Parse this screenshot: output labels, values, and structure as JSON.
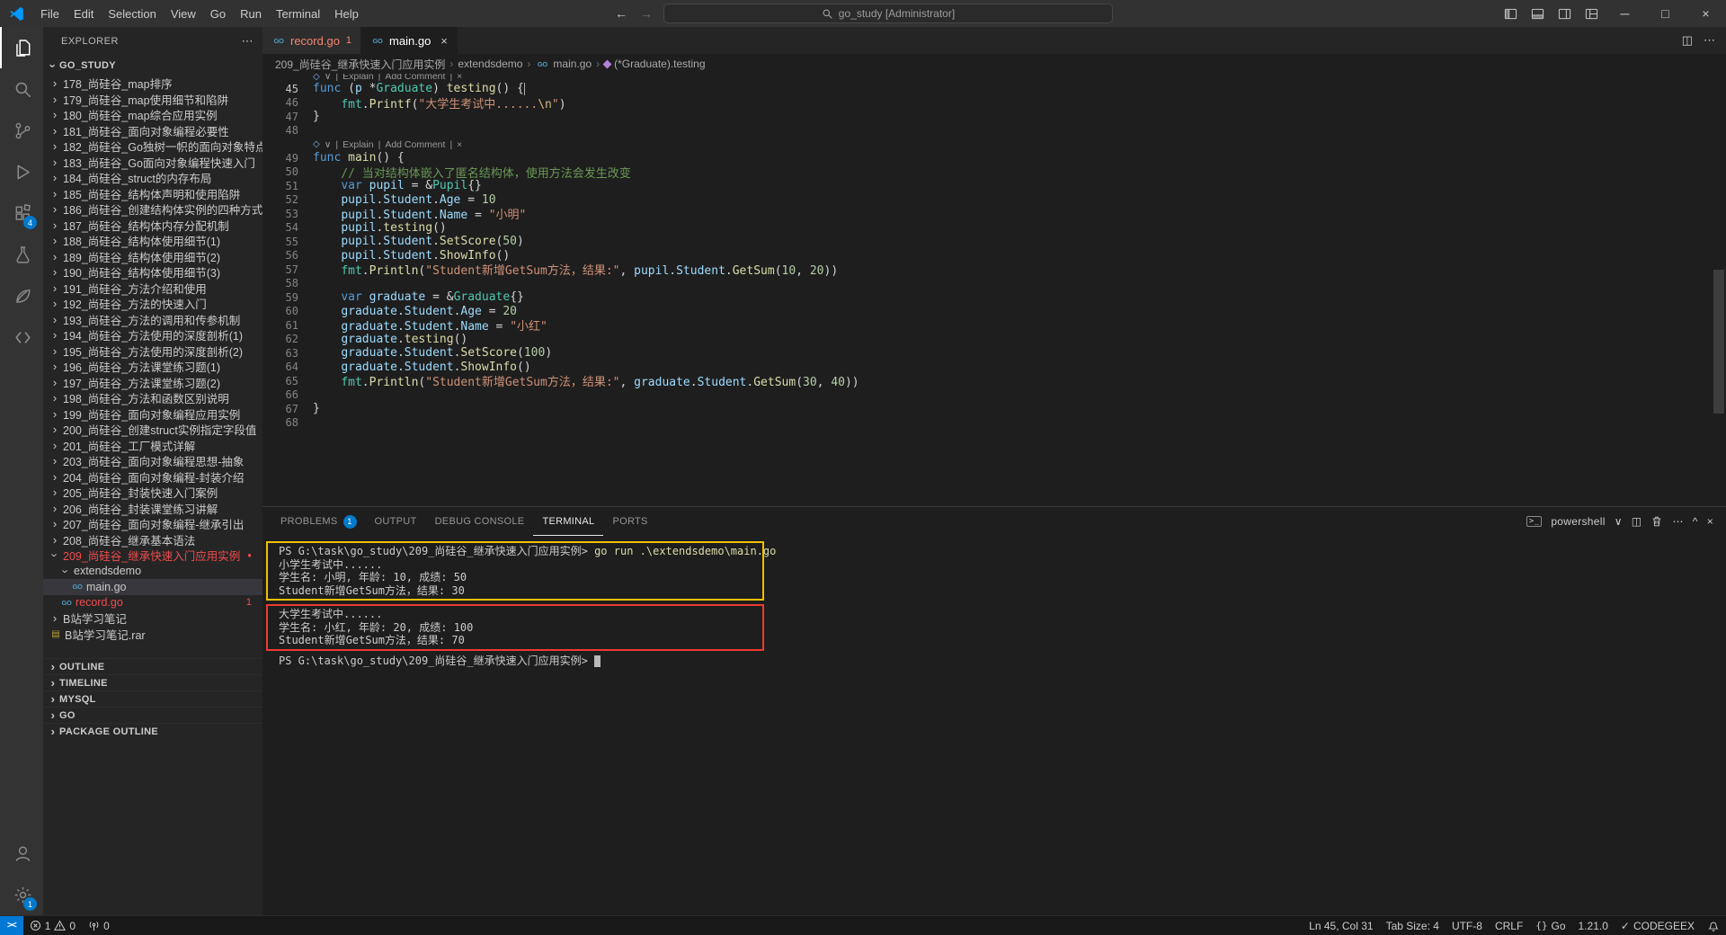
{
  "colors": {
    "accent": "#007acc",
    "error": "#f14c4c",
    "box_yellow": "#f0c000",
    "box_red": "#ee3b30"
  },
  "icons": {
    "chevron": "›",
    "more": "⋯",
    "close": "×",
    "dropdown": "∨",
    "split": "◫",
    "go_badge": "GO",
    "rar": "▤",
    "dot": "●",
    "check": "✓",
    "min": "─",
    "max": "□",
    "back": "←",
    "forward": "→",
    "remote": "><",
    "caret_up": "^",
    "lens_diamond": "◇",
    "braces": "{}"
  },
  "titlebar": {
    "menus": [
      "File",
      "Edit",
      "Selection",
      "View",
      "Go",
      "Run",
      "Terminal",
      "Help"
    ],
    "search_text": "go_study [Administrator]"
  },
  "activitybar": {
    "extensions_badge": "4",
    "settings_badge": "1"
  },
  "sidebar": {
    "title": "EXPLORER",
    "section": "GO_STUDY",
    "rows": [
      {
        "kind": "folder",
        "level": 0,
        "label": "178_尚硅谷_map排序"
      },
      {
        "kind": "folder",
        "level": 0,
        "label": "179_尚硅谷_map使用细节和陷阱"
      },
      {
        "kind": "folder",
        "level": 0,
        "label": "180_尚硅谷_map综合应用实例"
      },
      {
        "kind": "folder",
        "level": 0,
        "label": "181_尚硅谷_面向对象编程必要性"
      },
      {
        "kind": "folder",
        "level": 0,
        "label": "182_尚硅谷_Go独树一帜的面向对象特点"
      },
      {
        "kind": "folder",
        "level": 0,
        "label": "183_尚硅谷_Go面向对象编程快速入门"
      },
      {
        "kind": "folder",
        "level": 0,
        "label": "184_尚硅谷_struct的内存布局"
      },
      {
        "kind": "folder",
        "level": 0,
        "label": "185_尚硅谷_结构体声明和使用陷阱"
      },
      {
        "kind": "folder",
        "level": 0,
        "label": "186_尚硅谷_创建结构体实例的四种方式"
      },
      {
        "kind": "folder",
        "level": 0,
        "label": "187_尚硅谷_结构体内存分配机制"
      },
      {
        "kind": "folder",
        "level": 0,
        "label": "188_尚硅谷_结构体使用细节(1)"
      },
      {
        "kind": "folder",
        "level": 0,
        "label": "189_尚硅谷_结构体使用细节(2)"
      },
      {
        "kind": "folder",
        "level": 0,
        "label": "190_尚硅谷_结构体使用细节(3)"
      },
      {
        "kind": "folder",
        "level": 0,
        "label": "191_尚硅谷_方法介绍和使用"
      },
      {
        "kind": "folder",
        "level": 0,
        "label": "192_尚硅谷_方法的快速入门"
      },
      {
        "kind": "folder",
        "level": 0,
        "label": "193_尚硅谷_方法的调用和传参机制"
      },
      {
        "kind": "folder",
        "level": 0,
        "label": "194_尚硅谷_方法使用的深度剖析(1)"
      },
      {
        "kind": "folder",
        "level": 0,
        "label": "195_尚硅谷_方法使用的深度剖析(2)"
      },
      {
        "kind": "folder",
        "level": 0,
        "label": "196_尚硅谷_方法课堂练习题(1)"
      },
      {
        "kind": "folder",
        "level": 0,
        "label": "197_尚硅谷_方法课堂练习题(2)"
      },
      {
        "kind": "folder",
        "level": 0,
        "label": "198_尚硅谷_方法和函数区别说明"
      },
      {
        "kind": "folder",
        "level": 0,
        "label": "199_尚硅谷_面向对象编程应用实例"
      },
      {
        "kind": "folder",
        "level": 0,
        "label": "200_尚硅谷_创建struct实例指定字段值"
      },
      {
        "kind": "folder",
        "level": 0,
        "label": "201_尚硅谷_工厂模式详解"
      },
      {
        "kind": "folder",
        "level": 0,
        "label": "203_尚硅谷_面向对象编程思想-抽象"
      },
      {
        "kind": "folder",
        "level": 0,
        "label": "204_尚硅谷_面向对象编程-封装介绍"
      },
      {
        "kind": "folder",
        "level": 0,
        "label": "205_尚硅谷_封装快速入门案例"
      },
      {
        "kind": "folder",
        "level": 0,
        "label": "206_尚硅谷_封装课堂练习讲解"
      },
      {
        "kind": "folder",
        "level": 0,
        "label": "207_尚硅谷_面向对象编程-继承引出"
      },
      {
        "kind": "folder",
        "level": 0,
        "label": "208_尚硅谷_继承基本语法"
      },
      {
        "kind": "folder",
        "level": 0,
        "label": "209_尚硅谷_继承快速入门应用实例",
        "expanded": true,
        "error": true,
        "dot": true
      },
      {
        "kind": "folder",
        "level": 1,
        "label": "extendsdemo",
        "expanded": true
      },
      {
        "kind": "file",
        "level": 2,
        "label": "main.go",
        "icon": "go",
        "selected": true
      },
      {
        "kind": "file",
        "level": 1,
        "label": "record.go",
        "icon": "go",
        "error": true,
        "badge": "1"
      },
      {
        "kind": "folder",
        "level": 0,
        "label": "B站学习笔记"
      },
      {
        "kind": "file",
        "level": 0,
        "label": "B站学习笔记.rar",
        "icon": "rar"
      }
    ],
    "panes": [
      "OUTLINE",
      "TIMELINE",
      "MYSQL",
      "GO",
      "PACKAGE OUTLINE"
    ]
  },
  "tabs": [
    {
      "label": "record.go",
      "badge": "1",
      "error": true
    },
    {
      "label": "main.go",
      "active": true
    }
  ],
  "breadcrumb": [
    {
      "label": "209_尚硅谷_继承快速入门应用实例"
    },
    {
      "label": "extendsdemo"
    },
    {
      "label": "main.go",
      "icon": "go"
    },
    {
      "label": "(*Graduate).testing",
      "icon": "method"
    }
  ],
  "codelens": {
    "items": [
      "Explain",
      "Add Comment"
    ]
  },
  "editor": {
    "active_line": 45,
    "lines": [
      {
        "lens": true,
        "clip": true
      },
      {
        "n": 45,
        "t": [
          [
            "kw",
            "func "
          ],
          [
            "pn",
            "("
          ],
          [
            "v",
            "p"
          ],
          [
            "pn",
            " *"
          ],
          [
            "ty",
            "Graduate"
          ],
          [
            "pn",
            ") "
          ],
          [
            "fn",
            "testing"
          ],
          [
            "pn",
            "() {"
          ]
        ]
      },
      {
        "n": 46,
        "t": [
          [
            "pn",
            "    "
          ],
          [
            "ty",
            "fmt"
          ],
          [
            "pn",
            "."
          ],
          [
            "fn",
            "Printf"
          ],
          [
            "pn",
            "("
          ],
          [
            "str",
            "\"大学生考试中......"
          ],
          [
            "esc",
            "\\n"
          ],
          [
            "str",
            "\""
          ],
          [
            "pn",
            ")"
          ]
        ]
      },
      {
        "n": 47,
        "t": [
          [
            "pn",
            "}"
          ]
        ]
      },
      {
        "n": 48,
        "t": []
      },
      {
        "lens": true
      },
      {
        "n": 49,
        "t": [
          [
            "kw",
            "func "
          ],
          [
            "fn",
            "main"
          ],
          [
            "pn",
            "() {"
          ]
        ]
      },
      {
        "n": 50,
        "t": [
          [
            "cmt",
            "    // 当对结构体嵌入了匿名结构体，使用方法会发生改变"
          ]
        ]
      },
      {
        "n": 51,
        "t": [
          [
            "pn",
            "    "
          ],
          [
            "kw",
            "var"
          ],
          [
            "pn",
            " "
          ],
          [
            "v",
            "pupil"
          ],
          [
            "pn",
            " = &"
          ],
          [
            "ty",
            "Pupil"
          ],
          [
            "pn",
            "{}"
          ]
        ]
      },
      {
        "n": 52,
        "t": [
          [
            "pn",
            "    "
          ],
          [
            "v",
            "pupil"
          ],
          [
            "pn",
            "."
          ],
          [
            "v",
            "Student"
          ],
          [
            "pn",
            "."
          ],
          [
            "v",
            "Age"
          ],
          [
            "pn",
            " = "
          ],
          [
            "num",
            "10"
          ]
        ]
      },
      {
        "n": 53,
        "t": [
          [
            "pn",
            "    "
          ],
          [
            "v",
            "pupil"
          ],
          [
            "pn",
            "."
          ],
          [
            "v",
            "Student"
          ],
          [
            "pn",
            "."
          ],
          [
            "v",
            "Name"
          ],
          [
            "pn",
            " = "
          ],
          [
            "str",
            "\"小明\""
          ]
        ]
      },
      {
        "n": 54,
        "t": [
          [
            "pn",
            "    "
          ],
          [
            "v",
            "pupil"
          ],
          [
            "pn",
            "."
          ],
          [
            "fn",
            "testing"
          ],
          [
            "pn",
            "()"
          ]
        ]
      },
      {
        "n": 55,
        "t": [
          [
            "pn",
            "    "
          ],
          [
            "v",
            "pupil"
          ],
          [
            "pn",
            "."
          ],
          [
            "v",
            "Student"
          ],
          [
            "pn",
            "."
          ],
          [
            "fn",
            "SetScore"
          ],
          [
            "pn",
            "("
          ],
          [
            "num",
            "50"
          ],
          [
            "pn",
            ")"
          ]
        ]
      },
      {
        "n": 56,
        "t": [
          [
            "pn",
            "    "
          ],
          [
            "v",
            "pupil"
          ],
          [
            "pn",
            "."
          ],
          [
            "v",
            "Student"
          ],
          [
            "pn",
            "."
          ],
          [
            "fn",
            "ShowInfo"
          ],
          [
            "pn",
            "()"
          ]
        ]
      },
      {
        "n": 57,
        "t": [
          [
            "pn",
            "    "
          ],
          [
            "ty",
            "fmt"
          ],
          [
            "pn",
            "."
          ],
          [
            "fn",
            "Println"
          ],
          [
            "pn",
            "("
          ],
          [
            "str",
            "\"Student新增GetSum方法，结果:\""
          ],
          [
            "pn",
            ", "
          ],
          [
            "v",
            "pupil"
          ],
          [
            "pn",
            "."
          ],
          [
            "v",
            "Student"
          ],
          [
            "pn",
            "."
          ],
          [
            "fn",
            "GetSum"
          ],
          [
            "pn",
            "("
          ],
          [
            "num",
            "10"
          ],
          [
            "pn",
            ", "
          ],
          [
            "num",
            "20"
          ],
          [
            "pn",
            "))"
          ]
        ]
      },
      {
        "n": 58,
        "t": []
      },
      {
        "n": 59,
        "t": [
          [
            "pn",
            "    "
          ],
          [
            "kw",
            "var"
          ],
          [
            "pn",
            " "
          ],
          [
            "v",
            "graduate"
          ],
          [
            "pn",
            " = &"
          ],
          [
            "ty",
            "Graduate"
          ],
          [
            "pn",
            "{}"
          ]
        ]
      },
      {
        "n": 60,
        "t": [
          [
            "pn",
            "    "
          ],
          [
            "v",
            "graduate"
          ],
          [
            "pn",
            "."
          ],
          [
            "v",
            "Student"
          ],
          [
            "pn",
            "."
          ],
          [
            "v",
            "Age"
          ],
          [
            "pn",
            " = "
          ],
          [
            "num",
            "20"
          ]
        ]
      },
      {
        "n": 61,
        "t": [
          [
            "pn",
            "    "
          ],
          [
            "v",
            "graduate"
          ],
          [
            "pn",
            "."
          ],
          [
            "v",
            "Student"
          ],
          [
            "pn",
            "."
          ],
          [
            "v",
            "Name"
          ],
          [
            "pn",
            " = "
          ],
          [
            "str",
            "\"小红\""
          ]
        ]
      },
      {
        "n": 62,
        "t": [
          [
            "pn",
            "    "
          ],
          [
            "v",
            "graduate"
          ],
          [
            "pn",
            "."
          ],
          [
            "fn",
            "testing"
          ],
          [
            "pn",
            "()"
          ]
        ]
      },
      {
        "n": 63,
        "t": [
          [
            "pn",
            "    "
          ],
          [
            "v",
            "graduate"
          ],
          [
            "pn",
            "."
          ],
          [
            "v",
            "Student"
          ],
          [
            "pn",
            "."
          ],
          [
            "fn",
            "SetScore"
          ],
          [
            "pn",
            "("
          ],
          [
            "num",
            "100"
          ],
          [
            "pn",
            ")"
          ]
        ]
      },
      {
        "n": 64,
        "t": [
          [
            "pn",
            "    "
          ],
          [
            "v",
            "graduate"
          ],
          [
            "pn",
            "."
          ],
          [
            "v",
            "Student"
          ],
          [
            "pn",
            "."
          ],
          [
            "fn",
            "ShowInfo"
          ],
          [
            "pn",
            "()"
          ]
        ]
      },
      {
        "n": 65,
        "t": [
          [
            "pn",
            "    "
          ],
          [
            "ty",
            "fmt"
          ],
          [
            "pn",
            "."
          ],
          [
            "fn",
            "Println"
          ],
          [
            "pn",
            "("
          ],
          [
            "str",
            "\"Student新增GetSum方法，结果:\""
          ],
          [
            "pn",
            ", "
          ],
          [
            "v",
            "graduate"
          ],
          [
            "pn",
            "."
          ],
          [
            "v",
            "Student"
          ],
          [
            "pn",
            "."
          ],
          [
            "fn",
            "GetSum"
          ],
          [
            "pn",
            "("
          ],
          [
            "num",
            "30"
          ],
          [
            "pn",
            ", "
          ],
          [
            "num",
            "40"
          ],
          [
            "pn",
            "))"
          ]
        ]
      },
      {
        "n": 66,
        "t": []
      },
      {
        "n": 67,
        "t": [
          [
            "pn",
            "}"
          ]
        ]
      },
      {
        "n": 68,
        "t": []
      }
    ]
  },
  "panel": {
    "tabs": [
      {
        "label": "PROBLEMS",
        "badge": "1"
      },
      {
        "label": "OUTPUT"
      },
      {
        "label": "DEBUG CONSOLE"
      },
      {
        "label": "TERMINAL",
        "active": true
      },
      {
        "label": "PORTS"
      }
    ],
    "shell": "powershell",
    "terminal": {
      "groups": [
        {
          "box": "yellow",
          "lines": [
            [
              [
                "p",
                "PS G:\\task\\go_study\\209_尚硅谷_继承快速入门应用实例> "
              ],
              [
                "c",
                "go run .\\extendsdemo\\main.go"
              ]
            ],
            [
              [
                "p",
                "小学生考试中......"
              ]
            ],
            [
              [
                "p",
                "学生名: 小明, 年龄: 10, 成绩: 50"
              ]
            ],
            [
              [
                "p",
                "Student新增GetSum方法，结果: 30"
              ]
            ]
          ]
        },
        {
          "box": "red",
          "lines": [
            [
              [
                "p",
                "大学生考试中......"
              ]
            ],
            [
              [
                "p",
                "学生名: 小红, 年龄: 20, 成绩: 100"
              ]
            ],
            [
              [
                "p",
                "Student新增GetSum方法，结果: 70"
              ]
            ]
          ]
        },
        {
          "box": null,
          "lines": [
            [
              [
                "p",
                "PS G:\\task\\go_study\\209_尚硅谷_继承快速入门应用实例> "
              ],
              [
                "cursor",
                ""
              ]
            ]
          ]
        }
      ]
    }
  },
  "statusbar": {
    "remote_label": "><",
    "errors": "1",
    "warnings": "0",
    "ports": "0",
    "line_col": "Ln 45, Col 31",
    "tab_size": "Tab Size: 4",
    "encoding": "UTF-8",
    "eol": "CRLF",
    "language": "Go",
    "go_version": "1.21.0",
    "codegeex": "CODEGEEX"
  }
}
